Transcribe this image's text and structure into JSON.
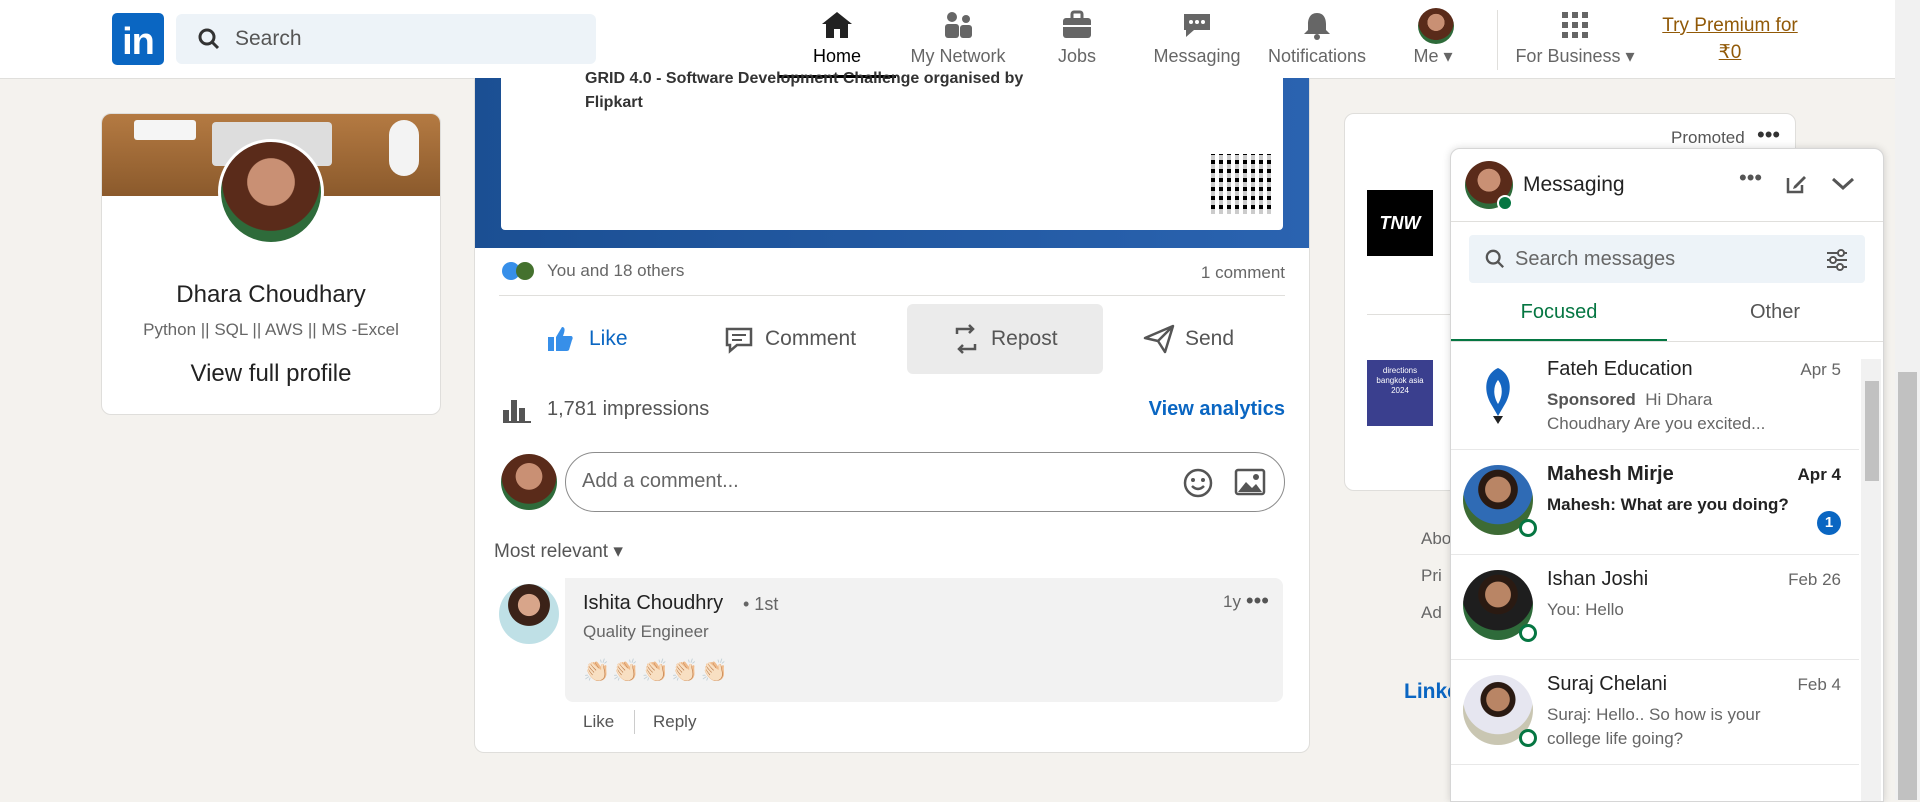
{
  "header": {
    "logo": "in",
    "search_placeholder": "Search",
    "nav": [
      {
        "label": "Home",
        "icon": "home-icon"
      },
      {
        "label": "My Network",
        "icon": "network-icon"
      },
      {
        "label": "Jobs",
        "icon": "briefcase-icon"
      },
      {
        "label": "Messaging",
        "icon": "chat-icon"
      },
      {
        "label": "Notifications",
        "icon": "bell-icon"
      },
      {
        "label": "Me",
        "icon": "avatar"
      },
      {
        "label": "For Business",
        "icon": "grid-icon"
      }
    ],
    "premium": [
      "Try Premium for",
      "₹0"
    ]
  },
  "profile": {
    "name": "Dhara Choudhary",
    "headline": "Python || SQL || AWS || MS -Excel",
    "view_link": "View full profile"
  },
  "post": {
    "cert_line1": "GRID 4.0 - Software Development Challenge organised by",
    "cert_line2": "Flipkart",
    "reactions": "You and 18 others",
    "comments": "1 comment",
    "actions": {
      "like": "Like",
      "comment": "Comment",
      "repost": "Repost",
      "send": "Send"
    },
    "impressions": "1,781 impressions",
    "analytics": "View analytics",
    "comment_placeholder": "Add a comment...",
    "sort": "Most relevant",
    "comment": {
      "author": "Ishita Choudhry",
      "degree": "• 1st",
      "role": "Quality Engineer",
      "time": "1y",
      "text": "👏🏻👏🏻👏🏻👏🏻👏🏻",
      "like": "Like",
      "reply": "Reply"
    }
  },
  "ad": {
    "promoted": "Promoted",
    "brand1": "TNW",
    "brand2": "directions bangkok asia 2024",
    "footer_links": [
      "Abo",
      "Pri",
      "Ad"
    ],
    "footer_brand": "Linke"
  },
  "messaging": {
    "title": "Messaging",
    "search_placeholder": "Search messages",
    "tabs": {
      "focused": "Focused",
      "other": "Other"
    },
    "conversations": [
      {
        "name": "Fateh Education",
        "date": "Apr 5",
        "sponsored": "Sponsored",
        "preview": "Hi Dhara Choudhary Are you excited..."
      },
      {
        "name": "Mahesh Mirje",
        "date": "Apr 4",
        "preview": "Mahesh: What are you doing?",
        "unread": "1"
      },
      {
        "name": "Ishan Joshi",
        "date": "Feb 26",
        "preview": "You: Hello"
      },
      {
        "name": "Suraj Chelani",
        "date": "Feb 4",
        "preview": "Suraj: Hello.. So how is your college life going?"
      }
    ]
  },
  "colors": {
    "brand": "#0a66c2",
    "accent_green": "#057642",
    "premium": "#915907"
  }
}
